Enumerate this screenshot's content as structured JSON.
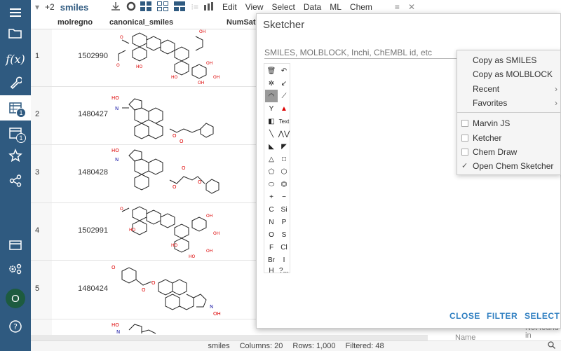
{
  "sidebar": {
    "badge_tables": "1",
    "badge_windows": "1",
    "avatar_letter": "O"
  },
  "toolbar": {
    "extra_count": "+2",
    "title": "smiles",
    "menus": [
      "Edit",
      "View",
      "Select",
      "Data",
      "ML",
      "Chem"
    ]
  },
  "grid": {
    "columns": [
      "molregno",
      "canonical_smiles",
      "NumSatu"
    ],
    "rows": [
      {
        "num": "1",
        "molregno": "1502990"
      },
      {
        "num": "2",
        "molregno": "1480427"
      },
      {
        "num": "3",
        "molregno": "1480428"
      },
      {
        "num": "4",
        "molregno": "1502991"
      },
      {
        "num": "5",
        "molregno": "1480424"
      }
    ]
  },
  "dialog": {
    "title": "Sketcher",
    "placeholder": "SMILES, MOLBLOCK, Inchi, ChEMBL id, etc",
    "buttons": {
      "close": "CLOSE",
      "filter": "FILTER",
      "select": "SELECT"
    },
    "tools_text": [
      "Text",
      "C",
      "Si",
      "N",
      "P",
      "O",
      "S",
      "F",
      "Cl",
      "Br",
      "I",
      "H",
      "?..."
    ]
  },
  "menu": {
    "copy_smiles": "Copy as SMILES",
    "copy_molblock": "Copy as MOLBLOCK",
    "recent": "Recent",
    "favorites": "Favorites",
    "marvin": "Marvin JS",
    "ketcher": "Ketcher",
    "chemdraw": "Chem Draw",
    "open_chem": "Open Chem Sketcher"
  },
  "side_panel": {
    "name_label": "Name",
    "not_found": "Not found in"
  },
  "status": {
    "table": "smiles",
    "columns": "Columns: 20",
    "rows": "Rows: 1,000",
    "filtered": "Filtered: 48"
  }
}
